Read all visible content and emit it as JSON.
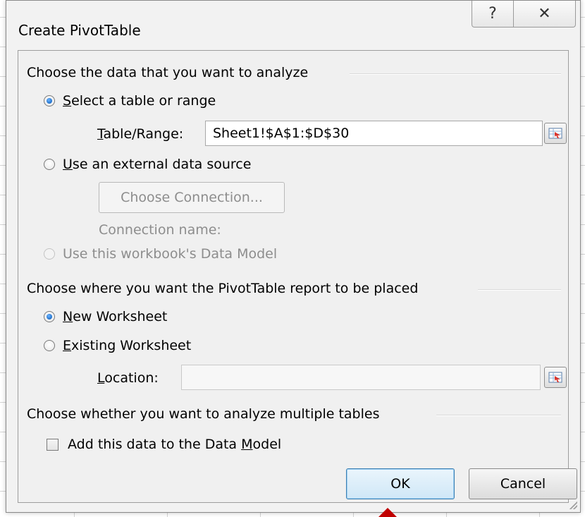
{
  "dialog": {
    "title": "Create PivotTable",
    "help_glyph": "?",
    "close_glyph": "✕"
  },
  "section_data": {
    "heading": "Choose the data that you want to analyze",
    "opt_table": {
      "accel": "S",
      "rest": "elect a table or range",
      "checked": true
    },
    "table_range_label_accel": "T",
    "table_range_label_rest": "able/Range:",
    "table_range_value": "Sheet1!$A$1:$D$30",
    "opt_external": {
      "accel": "U",
      "rest": "se an external data source",
      "checked": false
    },
    "choose_connection_button": "Choose Connection...",
    "connection_name_label": "Connection name:",
    "opt_data_model": {
      "label": "Use this workbook's Data Model",
      "enabled": false
    }
  },
  "section_place": {
    "heading": "Choose where you want the PivotTable report to be placed",
    "opt_new": {
      "accel": "N",
      "rest": "ew Worksheet",
      "checked": true
    },
    "opt_existing": {
      "accel": "E",
      "rest": "xisting Worksheet",
      "checked": false
    },
    "location_label_accel": "L",
    "location_label_rest": "ocation:",
    "location_value": ""
  },
  "section_multi": {
    "heading": "Choose whether you want to analyze multiple tables",
    "checkbox_pre": "Add this data to the Data ",
    "checkbox_accel": "M",
    "checkbox_post": "odel",
    "checked": false
  },
  "buttons": {
    "ok": "OK",
    "cancel": "Cancel"
  },
  "colors": {
    "accent_radio": "#1f6fc9",
    "disabled_text": "#8d8d8d",
    "range_icon_red": "#d9342b"
  }
}
